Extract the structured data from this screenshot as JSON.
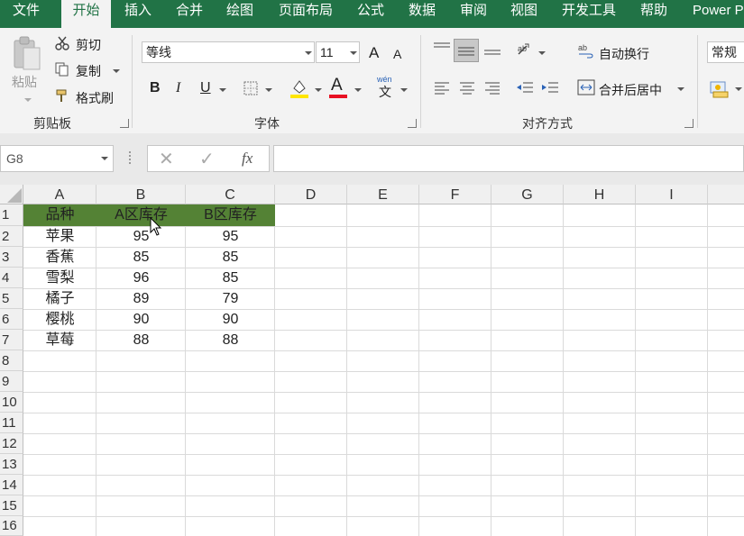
{
  "ribbon_tabs": [
    "文件",
    "开始",
    "插入",
    "合并",
    "绘图",
    "页面布局",
    "公式",
    "数据",
    "审阅",
    "视图",
    "开发工具",
    "帮助",
    "Power P"
  ],
  "clipboard": {
    "paste": "粘贴",
    "cut": "剪切",
    "copy": "复制",
    "format_painter": "格式刷",
    "group_label": "剪贴板"
  },
  "font": {
    "name": "等线",
    "size": "11",
    "bold": "B",
    "italic": "I",
    "underline": "U",
    "grow": "A",
    "shrink": "A",
    "font_color_glyph": "A",
    "phonetic_top": "wén",
    "phonetic_bottom": "文",
    "group_label": "字体"
  },
  "alignment": {
    "wrap_text": "自动换行",
    "merge_center": "合并后居中",
    "group_label": "对齐方式"
  },
  "number": {
    "format": "常规"
  },
  "formula_bar": {
    "name_box": "G8",
    "cancel": "✕",
    "enter": "✓",
    "fx": "fx",
    "formula": ""
  },
  "columns": [
    "A",
    "B",
    "C",
    "D",
    "E",
    "F",
    "G",
    "H",
    "I"
  ],
  "rows": [
    "1",
    "2",
    "3",
    "4",
    "5",
    "6",
    "7",
    "8",
    "9",
    "10",
    "11",
    "12",
    "13",
    "14",
    "15",
    "16"
  ],
  "table": {
    "header": [
      "品种",
      "A区库存",
      "B区库存"
    ],
    "data": [
      [
        "苹果",
        "95",
        "95"
      ],
      [
        "香蕉",
        "85",
        "85"
      ],
      [
        "雪梨",
        "96",
        "85"
      ],
      [
        "橘子",
        "89",
        "79"
      ],
      [
        "樱桃",
        "90",
        "90"
      ],
      [
        "草莓",
        "88",
        "88"
      ]
    ]
  },
  "colors": {
    "accent": "#217346",
    "header_fill": "#548235"
  }
}
